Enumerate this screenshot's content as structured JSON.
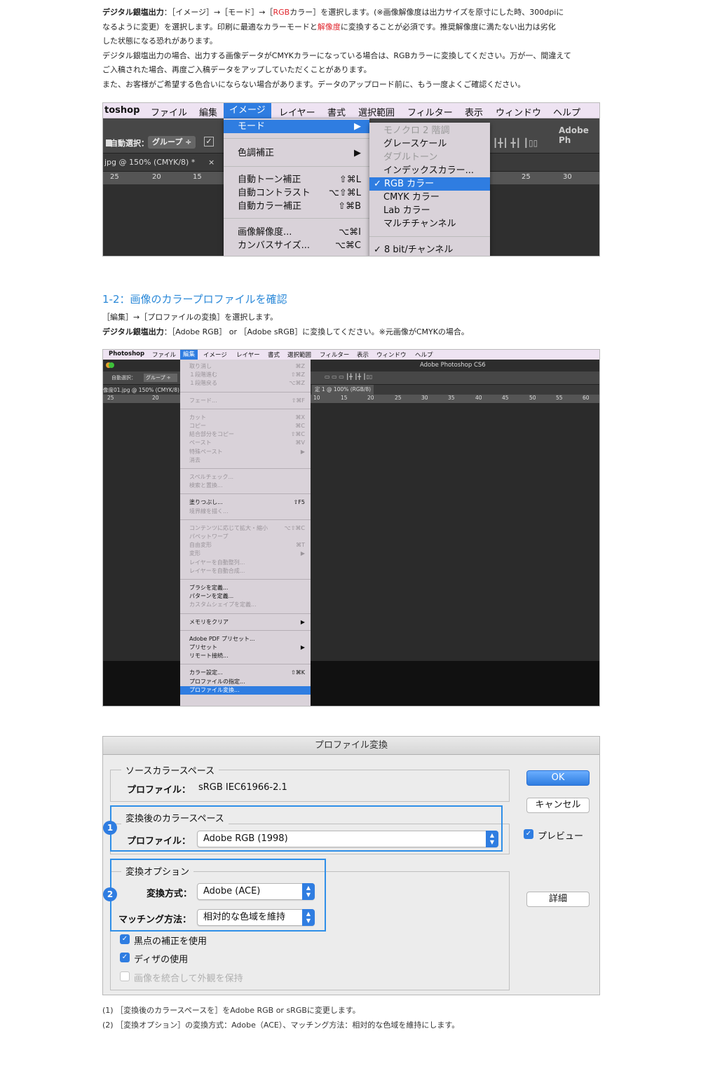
{
  "intro": {
    "l1_bold": "デジタル銀塩出力",
    "l1_a": "：［イメージ］→［モード］→［",
    "l1_red": "RGB",
    "l1_b": "カラー］を選択します。(※画像解像度は出力サイズを原寸にした時、300dpiに",
    "l2_a": "なるように変更）を選択します。印刷に最適なカラーモードと",
    "l2_red": "解像度",
    "l2_b": "に変換することが必須です。推奨解像度に満たない出力は劣化",
    "l3": "した状態になる恐れがあります。",
    "l4": "デジタル銀塩出力の場合、出力する画像データがCMYKカラーになっている場合は、RGBカラーに変換してください。万が一、間違えて",
    "l5": "ご入稿された場合、再度ご入稿データをアップしていただくことがあります。",
    "l6": "また、お客様がご希望する色合いにならない場合があります。データのアップロード前に、もう一度よくご確認ください。"
  },
  "shot1": {
    "menubar": [
      "toshop",
      "ファイル",
      "編集",
      "イメージ",
      "レイヤー",
      "書式",
      "選択範囲",
      "フィルター",
      "表示",
      "ウィンドウ",
      "ヘルプ"
    ],
    "app_title": "Adobe Ph",
    "tool_auto": "自動選択：",
    "tool_group": "グループ ÷",
    "doc_tab": "jpg @ 150% (CMYK/8) *",
    "ruler": [
      "25",
      "20",
      "15",
      "25",
      "30"
    ],
    "image_menu": {
      "mode": "モード",
      "adjust": "色調補正",
      "auto_tone": "自動トーン補正",
      "auto_tone_sc": "⇧⌘L",
      "auto_contrast": "自動コントラスト",
      "auto_contrast_sc": "⌥⇧⌘L",
      "auto_color": "自動カラー補正",
      "auto_color_sc": "⇧⌘B",
      "image_size": "画像解像度...",
      "image_size_sc": "⌥⌘I",
      "canvas_size": "カンバスサイズ...",
      "canvas_size_sc": "⌥⌘C"
    },
    "mode_menu": {
      "mono2": "モノクロ 2 階調",
      "gray": "グレースケール",
      "duotone": "ダブルトーン",
      "indexed": "インデックスカラー...",
      "rgb": "✓ RGB カラー",
      "cmyk": "CMYK カラー",
      "lab": "Lab カラー",
      "multi": "マルチチャンネル",
      "bit8": "✓ 8 bit/チャンネル"
    }
  },
  "section2": {
    "heading": "1-2：画像のカラープロファイルを確認",
    "l1": "［編集］→［プロファイルの変換］を選択します。",
    "l2_bold": "デジタル銀塩出力",
    "l2": "：［Adobe RGB］ or ［Adobe sRGB］に変換してください。※元画像がCMYKの場合。"
  },
  "shot2": {
    "menubar": [
      "Photoshop",
      "ファイル",
      "編集",
      "イメージ",
      "レイヤー",
      "書式",
      "選択範囲",
      "フィルター",
      "表示",
      "ウィンドウ",
      "ヘルプ"
    ],
    "app_title": "Adobe Photoshop CS6",
    "tool_auto": "自動選択：",
    "tool_group": "グループ ÷",
    "doc_left": "像度01.jpg @ 150% (CMYK/8)",
    "doc_right": "定 1 @ 100% (RGB/8)",
    "ruler_left": [
      "25",
      "20"
    ],
    "ruler_right": [
      "10",
      "15",
      "20",
      "25",
      "30",
      "35",
      "40",
      "45",
      "50",
      "55",
      "60"
    ],
    "edit_menu": [
      {
        "t": "取り消し",
        "s": "⌘Z",
        "d": true
      },
      {
        "t": "１段階進む",
        "s": "⇧⌘Z",
        "d": true
      },
      {
        "t": "１段階戻る",
        "s": "⌥⌘Z",
        "d": true
      },
      {
        "t": "フェード...",
        "s": "⇧⌘F",
        "d": true
      },
      {
        "t": "カット",
        "s": "⌘X",
        "d": true
      },
      {
        "t": "コピー",
        "s": "⌘C",
        "d": true
      },
      {
        "t": "結合部分をコピー",
        "s": "⇧⌘C",
        "d": true
      },
      {
        "t": "ペースト",
        "s": "⌘V",
        "d": true
      },
      {
        "t": "特殊ペースト",
        "s": "▶",
        "d": true
      },
      {
        "t": "消去",
        "s": "",
        "d": true
      },
      {
        "t": "スペルチェック...",
        "s": "",
        "d": true
      },
      {
        "t": "検索と置換...",
        "s": "",
        "d": true
      },
      {
        "t": "塗りつぶし...",
        "s": "⇧F5",
        "d": false
      },
      {
        "t": "境界線を描く...",
        "s": "",
        "d": true
      },
      {
        "t": "コンテンツに応じて拡大・縮小",
        "s": "⌥⇧⌘C",
        "d": true
      },
      {
        "t": "パペットワープ",
        "s": "",
        "d": true
      },
      {
        "t": "自由変形",
        "s": "⌘T",
        "d": true
      },
      {
        "t": "変形",
        "s": "▶",
        "d": true
      },
      {
        "t": "レイヤーを自動整列...",
        "s": "",
        "d": true
      },
      {
        "t": "レイヤーを自動合成...",
        "s": "",
        "d": true
      },
      {
        "t": "ブラシを定義...",
        "s": "",
        "d": false
      },
      {
        "t": "パターンを定義...",
        "s": "",
        "d": false
      },
      {
        "t": "カスタムシェイプを定義...",
        "s": "",
        "d": true
      },
      {
        "t": "メモリをクリア",
        "s": "▶",
        "d": false
      },
      {
        "t": "Adobe PDF プリセット...",
        "s": "",
        "d": false
      },
      {
        "t": "プリセット",
        "s": "▶",
        "d": false
      },
      {
        "t": "リモート接続...",
        "s": "",
        "d": false
      },
      {
        "t": "カラー設定...",
        "s": "⇧⌘K",
        "d": false
      },
      {
        "t": "プロファイルの指定...",
        "s": "",
        "d": false
      },
      {
        "t": "プロファイル変換...",
        "s": "",
        "d": false
      }
    ]
  },
  "dialog": {
    "title": "プロファイル変換",
    "source_label": "ソースカラースペース",
    "profile_label": "プロファイル：",
    "source_profile": "sRGB IEC61966-2.1",
    "dest_label": "変換後のカラースペース",
    "dest_profile_label": "プロファイル：",
    "dest_profile": "Adobe RGB (1998)",
    "options_label": "変換オプション",
    "engine_label": "変換方式：",
    "engine": "Adobe (ACE)",
    "intent_label": "マッチング方法：",
    "intent": "相対的な色域を維持",
    "blackpoint": "黒点の補正を使用",
    "dither": "ディザの使用",
    "flatten": "画像を統合して外観を保持",
    "ok": "OK",
    "cancel": "キャンセル",
    "preview": "プレビュー",
    "advanced": "詳細",
    "badge1": "1",
    "badge2": "2"
  },
  "footnotes": {
    "n1": "(1) ［変換後のカラースペースを］をAdobe RGB or sRGBに変更します。",
    "n2": "(2) ［変換オプション］の変換方式：Adobe（ACE）、マッチング方法：相対的な色域を維持にします。"
  },
  "colors": {
    "accent_blue": "#2f7de1",
    "heading_blue": "#2a88d8",
    "red": "#e0232b"
  }
}
